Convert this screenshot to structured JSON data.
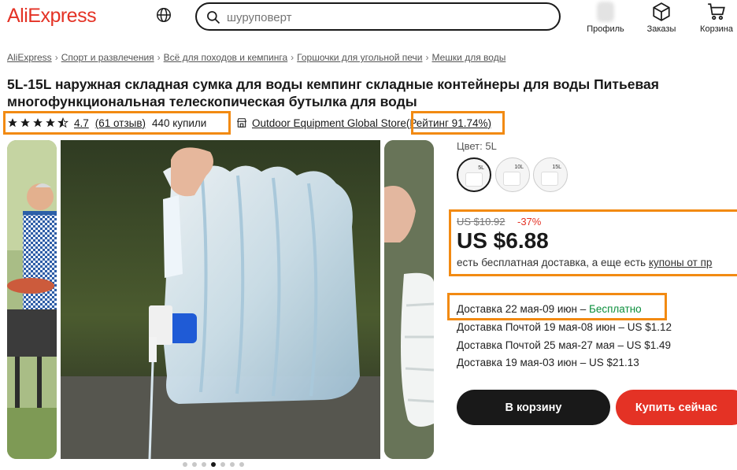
{
  "header": {
    "logo": "AliExpress",
    "search_placeholder": "шуруповерт",
    "nav": {
      "profile": "Профиль",
      "orders": "Заказы",
      "cart": "Корзина"
    }
  },
  "breadcrumb": [
    "AliExpress",
    "Спорт и развлечения",
    "Всё для походов и кемпинга",
    "Горшочки для угольной печи",
    "Мешки для воды"
  ],
  "product": {
    "title": "5L-15L наружная складная сумка для воды кемпинг складные контейнеры для воды Питьевая многофункциональная телескопическая бутылка для воды",
    "rating": "4.7",
    "reviews": "(61 отзыв)",
    "sold": "440 купили",
    "rating_value": 4.7,
    "store_name": "Outdoor Equipment Global Store",
    "store_rating": "(Рейтинг 91.74%)"
  },
  "gallery": {
    "dots": 7,
    "active_dot": 3
  },
  "variant": {
    "label": "Цвет: 5L",
    "swatches": [
      {
        "tag": "5L",
        "selected": true
      },
      {
        "tag": "10L",
        "selected": false
      },
      {
        "tag": "15L",
        "selected": false
      }
    ]
  },
  "price": {
    "old": "US $10.92",
    "discount": "-37%",
    "current": "US $6.88",
    "shipping_note_prefix": "есть бесплатная доставка, а еще есть ",
    "shipping_note_link": "купоны от пр"
  },
  "shipping": [
    {
      "text": "Доставка 22 мая-09 июн – ",
      "extra": "Бесплатно"
    },
    {
      "text": "Доставка Почтой 19 мая-08 июн – US $1.12",
      "extra": ""
    },
    {
      "text": "Доставка Почтой 25 мая-27 мая – US $1.49",
      "extra": ""
    },
    {
      "text": "Доставка 19 мая-03 июн – US $21.13",
      "extra": ""
    }
  ],
  "buttons": {
    "add_to_cart": "В корзину",
    "buy_now": "Купить сейчас"
  },
  "colors": {
    "brand": "#e43225",
    "highlight": "#f28a12",
    "free": "#0b8f3c"
  }
}
